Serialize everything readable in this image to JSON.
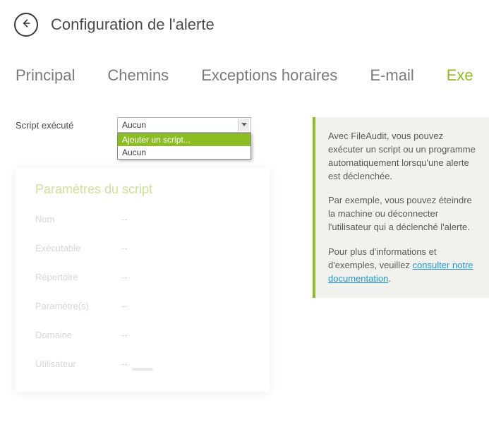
{
  "header": {
    "title": "Configuration de l'alerte"
  },
  "tabs": {
    "items": [
      {
        "label": "Principal",
        "active": false
      },
      {
        "label": "Chemins",
        "active": false
      },
      {
        "label": "Exceptions horaires",
        "active": false
      },
      {
        "label": "E-mail",
        "active": false
      },
      {
        "label": "Exe",
        "active": true
      }
    ]
  },
  "script_field": {
    "label": "Script exécuté",
    "selected": "Aucun",
    "options": [
      {
        "label": "Ajouter un script...",
        "highlight": true
      },
      {
        "label": "Aucun",
        "highlight": false
      }
    ]
  },
  "params": {
    "title": "Paramètres du script",
    "rows": [
      {
        "label": "Nom",
        "value": "--"
      },
      {
        "label": "Exécutable",
        "value": "--"
      },
      {
        "label": "Répertoire",
        "value": "--"
      },
      {
        "label": "Paramètre(s)",
        "value": "--"
      },
      {
        "label": "Domaine",
        "value": "--"
      },
      {
        "label": "Utilisateur",
        "value": "--"
      }
    ]
  },
  "info": {
    "p1": "Avec FileAudit, vous pouvez exécuter un script ou un programme automatiquement lorsqu'une alerte est déclenchée.",
    "p2": "Par exemple, vous pouvez éteindre la machine ou déconnecter l'utilisateur qui a déclenché l'alerte.",
    "p3_prefix": "Pour plus d'informations et d'exemples, veuillez ",
    "p3_link": "consulter notre documentation",
    "p3_suffix": "."
  }
}
